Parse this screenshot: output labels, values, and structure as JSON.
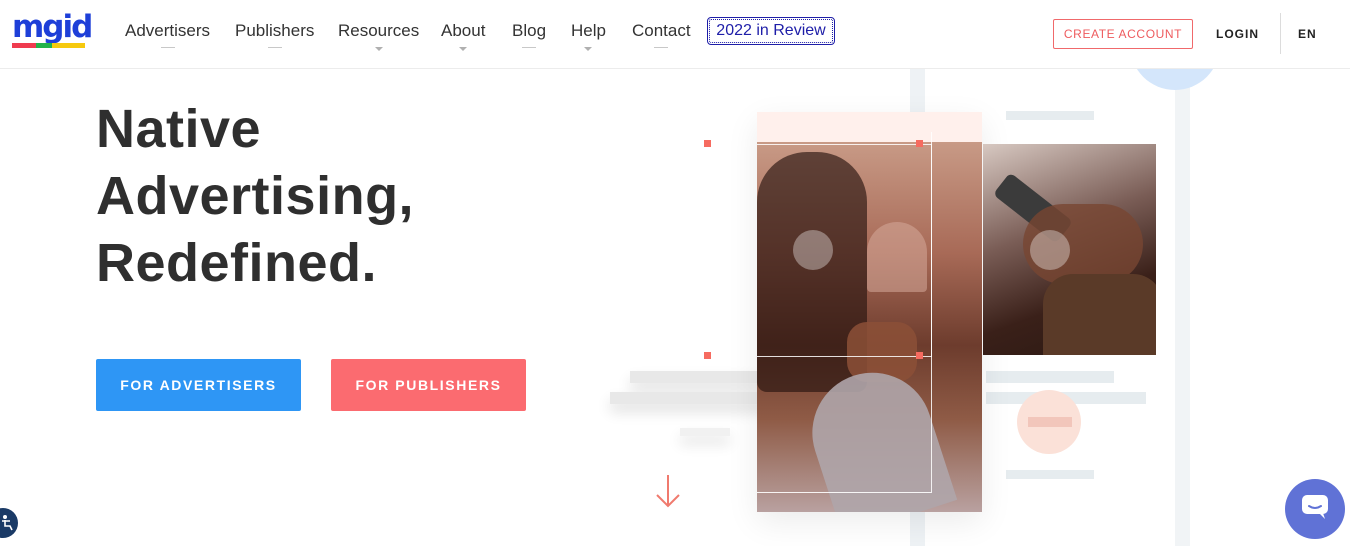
{
  "header": {
    "logo_text": "mgid",
    "nav": [
      {
        "label": "Advertisers",
        "indicator": "underline"
      },
      {
        "label": "Publishers",
        "indicator": "underline"
      },
      {
        "label": "Resources",
        "indicator": "caret"
      },
      {
        "label": "About",
        "indicator": "caret"
      },
      {
        "label": "Blog",
        "indicator": "underline"
      },
      {
        "label": "Help",
        "indicator": "caret"
      },
      {
        "label": "Contact",
        "indicator": "underline"
      }
    ],
    "review_button": "2022 in Review",
    "create_account": "CREATE ACCOUNT",
    "login": "LOGIN",
    "language": "EN"
  },
  "hero": {
    "headline_lines": [
      "Native",
      "Advertising,",
      "Redefined."
    ],
    "buttons": {
      "advertisers": "FOR ADVERTISERS",
      "publishers": "FOR PUBLISHERS"
    }
  },
  "icons": {
    "scroll_down": "arrow-down-icon",
    "chat": "chat-icon",
    "accessibility": "accessibility-icon"
  },
  "colors": {
    "brand_blue": "#2e96f5",
    "brand_coral": "#fb6b70",
    "logo_blue": "#1e3fd8",
    "review_navy": "#1e1ea8",
    "chat_purple": "#6072d6"
  }
}
